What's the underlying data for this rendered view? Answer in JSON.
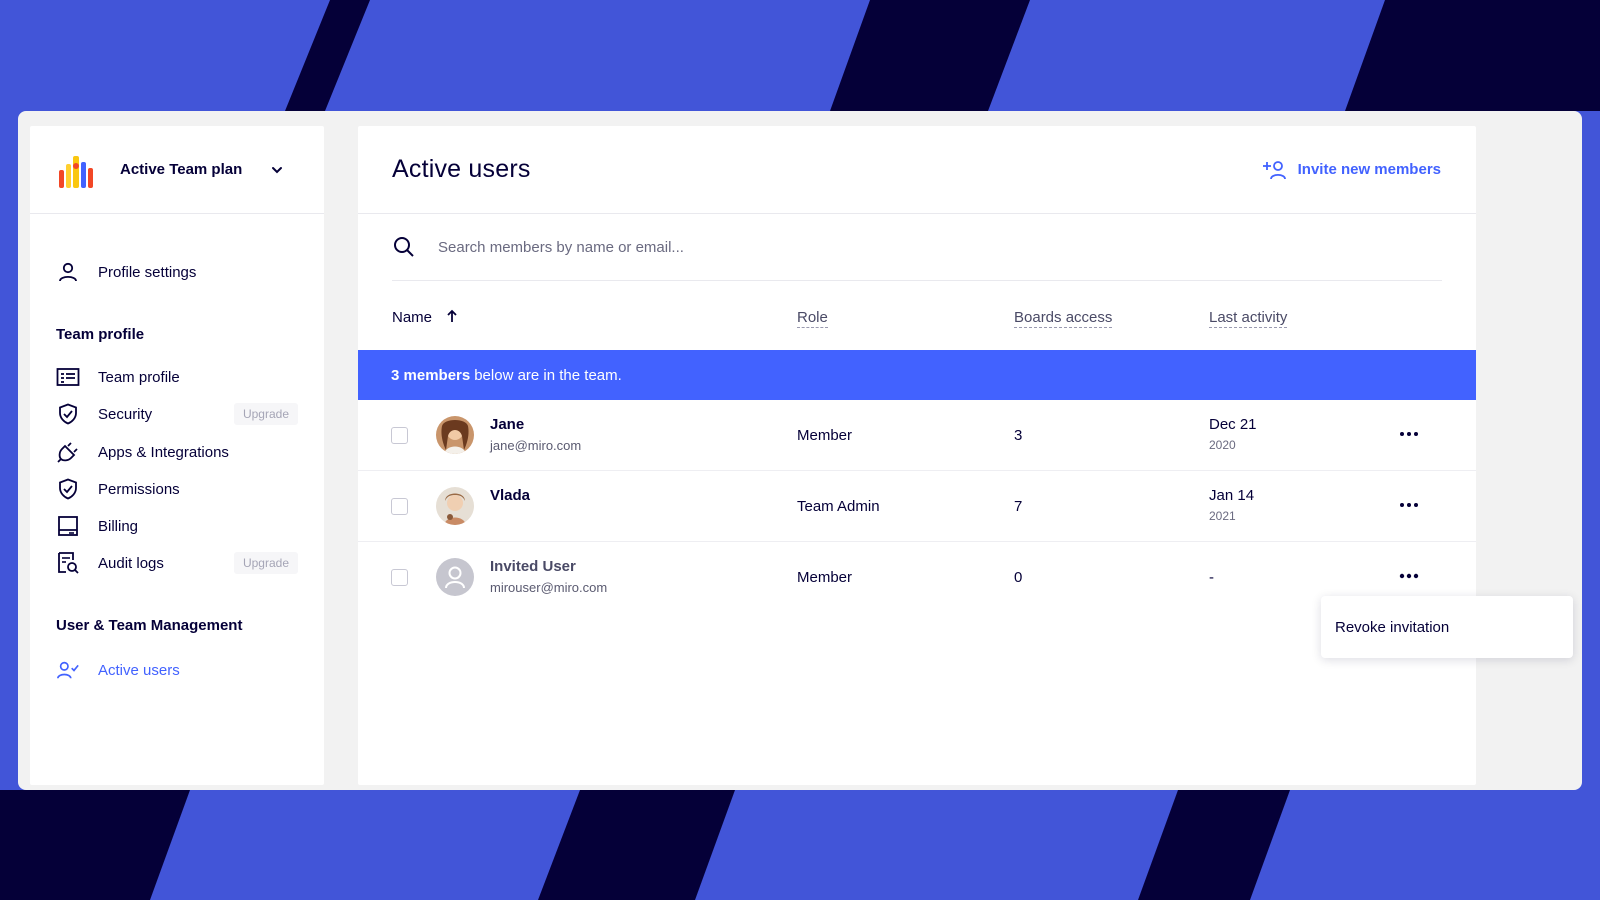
{
  "colors": {
    "accent": "#4262ff",
    "background": "#4255d8",
    "stripe": "#050038",
    "text": "#050038"
  },
  "sidebar": {
    "plan": {
      "label": "Active Team plan",
      "icon": "team-hands-logo",
      "dropdown_icon": "chevron-down-icon"
    },
    "profile_settings": {
      "label": "Profile settings",
      "icon": "user-icon"
    },
    "team_profile_section": "Team profile",
    "items": [
      {
        "label": "Team profile",
        "icon": "id-card-icon",
        "badge": ""
      },
      {
        "label": "Security",
        "icon": "shield-icon",
        "badge": "Upgrade"
      },
      {
        "label": "Apps & Integrations",
        "icon": "plug-icon",
        "badge": ""
      },
      {
        "label": "Permissions",
        "icon": "shield-check-icon",
        "badge": ""
      },
      {
        "label": "Billing",
        "icon": "billing-icon",
        "badge": ""
      },
      {
        "label": "Audit logs",
        "icon": "audit-log-icon",
        "badge": "Upgrade"
      }
    ],
    "management_section": "User & Team Management",
    "active_users": {
      "label": "Active users",
      "icon": "user-check-icon"
    }
  },
  "main": {
    "title": "Active users",
    "invite_label": "Invite new members",
    "search": {
      "placeholder": "Search members by name or email...",
      "value": ""
    },
    "columns": {
      "name": "Name",
      "sort": "ascending",
      "role": "Role",
      "boards": "Boards access",
      "activity": "Last activity"
    },
    "banner": {
      "count": "3 members",
      "text": "below are in the team."
    },
    "rows": [
      {
        "name": "Jane",
        "email": "jane@miro.com",
        "role": "Member",
        "boards": "3",
        "date": "Dec 21",
        "year": "2020"
      },
      {
        "name": "Vlada",
        "email": "",
        "role": "Team Admin",
        "boards": "7",
        "date": "Jan 14",
        "year": "2021"
      },
      {
        "name": "Invited User",
        "email": "mirouser@miro.com",
        "role": "Member",
        "boards": "0",
        "date": "-",
        "year": ""
      }
    ]
  },
  "dropdown": {
    "item": "Revoke invitation"
  }
}
